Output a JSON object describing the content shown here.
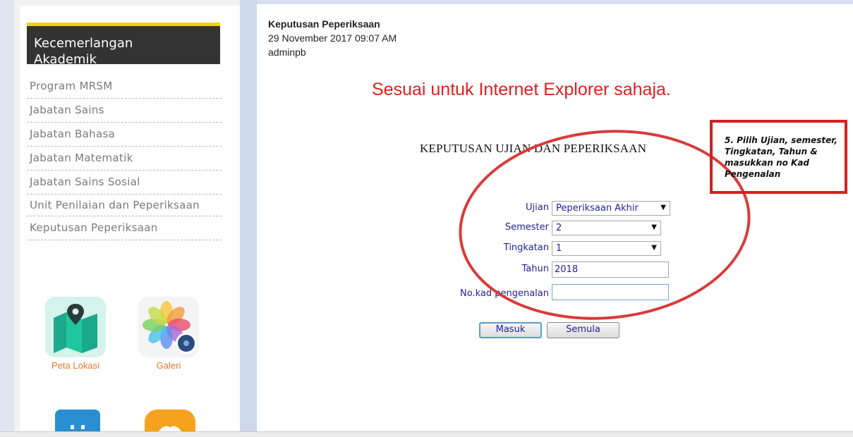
{
  "sidebar": {
    "header": "Kecemerlangan Akademik",
    "menu": [
      {
        "label": "Program MRSM"
      },
      {
        "label": "Jabatan Sains"
      },
      {
        "label": "Jabatan Bahasa"
      },
      {
        "label": "Jabatan Matematik"
      },
      {
        "label": "Jabatan Sains Sosial"
      },
      {
        "label": "Unit Penilaian dan Peperiksaan"
      },
      {
        "label": "Keputusan Peperiksaan"
      }
    ],
    "tiles": [
      {
        "icon": "map-icon",
        "caption": "Peta Lokasi"
      },
      {
        "icon": "photos-icon",
        "caption": "Galeri"
      }
    ]
  },
  "post": {
    "title": "Keputusan Peperiksaan",
    "date": "29 November 2017 09:07 AM",
    "author": "adminpb"
  },
  "notice": "Sesuai untuk Internet Explorer sahaja.",
  "form": {
    "heading": "KEPUTUSAN UJIAN DAN PEPERIKSAAN",
    "ujian_label": "Ujian",
    "ujian_value": "Peperiksaan Akhir",
    "semester_label": "Semester",
    "semester_value": "2",
    "tingkatan_label": "Tingkatan",
    "tingkatan_value": "1",
    "tahun_label": "Tahun",
    "tahun_value": "2018",
    "ic_label": "No.kad pengenalan",
    "ic_value": "",
    "submit_label": "Masuk",
    "reset_label": "Semula"
  },
  "callout": {
    "text": "5. Pilih Ujian, semester, Tingkatan, Tahun & masukkan no Kad Pengenalan"
  },
  "colors": {
    "accent_yellow": "#f0d400",
    "annotation_red": "#d42020",
    "link_blue": "#1f1f9a",
    "caption_orange": "#e47a2b"
  }
}
